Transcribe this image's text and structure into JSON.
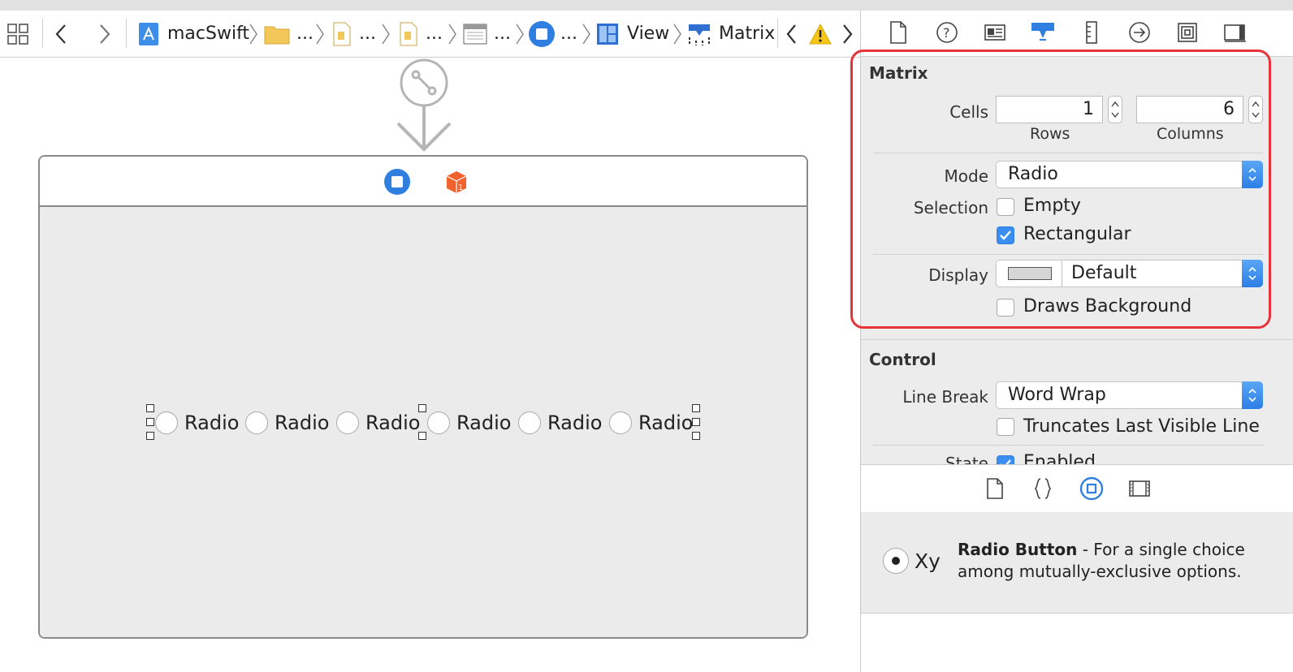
{
  "jumpbar": {
    "items": [
      {
        "label": "macSwift"
      },
      {
        "label": "..."
      },
      {
        "label": "..."
      },
      {
        "label": "..."
      },
      {
        "label": "..."
      },
      {
        "label": "..."
      },
      {
        "label": "View"
      },
      {
        "label": "Matrix"
      }
    ]
  },
  "canvas": {
    "radios": [
      "Radio",
      "Radio",
      "Radio",
      "Radio",
      "Radio",
      "Radio"
    ]
  },
  "inspector": {
    "matrix_section": {
      "title": "Matrix",
      "cells_label": "Cells",
      "rows_value": "1",
      "rows_caption": "Rows",
      "columns_value": "6",
      "columns_caption": "Columns",
      "mode_label": "Mode",
      "mode_value": "Radio",
      "selection_label": "Selection",
      "empty_label": "Empty",
      "empty_checked": false,
      "rectangular_label": "Rectangular",
      "rectangular_checked": true,
      "display_label": "Display",
      "display_value": "Default",
      "draws_background_label": "Draws Background",
      "draws_background_checked": false
    },
    "control_section": {
      "title": "Control",
      "line_break_label": "Line Break",
      "line_break_value": "Word Wrap",
      "truncates_label": "Truncates Last Visible Line",
      "state_label": "State",
      "enabled_label": "Enabled"
    },
    "library": {
      "item_title": "Radio Button",
      "item_desc_1": " - For a single choice",
      "item_desc_2": "among mutually-exclusive options.",
      "preview_text": "Xy"
    }
  },
  "colors": {
    "accent": "#2f7fe0",
    "highlight": "#e8333a"
  }
}
